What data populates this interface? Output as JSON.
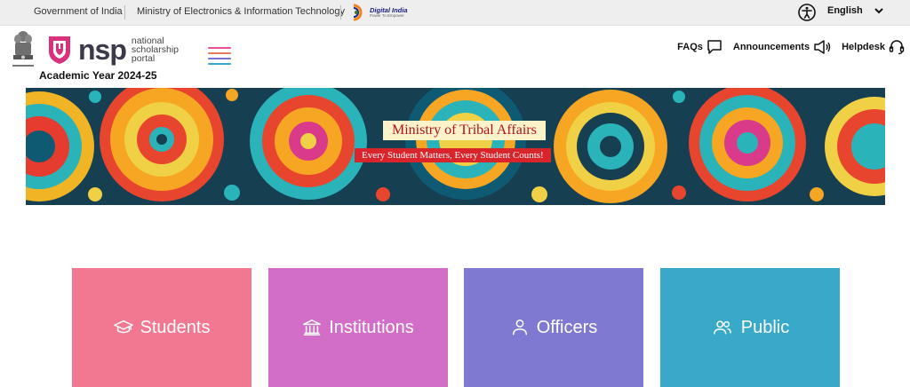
{
  "gov_bar": {
    "government_link": "Government of India",
    "ministry_link": "Ministry of Electronics & Information Technology",
    "digital_india_title": "Digital India",
    "digital_india_sub": "Power To Empower",
    "language": "English"
  },
  "header": {
    "logo_letters": "nsp",
    "logo_tag": [
      "national",
      "scholarship",
      "portal"
    ],
    "academic_year": "Academic Year 2024-25",
    "nav": [
      {
        "label": "FAQs",
        "icon": "chat-icon"
      },
      {
        "label": "Announcements",
        "icon": "megaphone-icon"
      },
      {
        "label": "Helpdesk",
        "icon": "headset-icon"
      }
    ]
  },
  "banner": {
    "title": "Ministry of Tribal Affairs",
    "tagline": "Every Student Matters, Every Student Counts!"
  },
  "cards": [
    {
      "label": "Students",
      "icon": "graduation-cap-icon",
      "color": "#f27891"
    },
    {
      "label": "Institutions",
      "icon": "institution-icon",
      "color": "#d26ec8"
    },
    {
      "label": "Officers",
      "icon": "officer-icon",
      "color": "#7f79d1"
    },
    {
      "label": "Public",
      "icon": "people-icon",
      "color": "#38a9c8"
    }
  ],
  "colors": {
    "hamburger_lines": [
      "#e8519a",
      "#e87a5c",
      "#7b6fd6",
      "#38a9c8"
    ],
    "logo_shield": "#d8337a"
  }
}
